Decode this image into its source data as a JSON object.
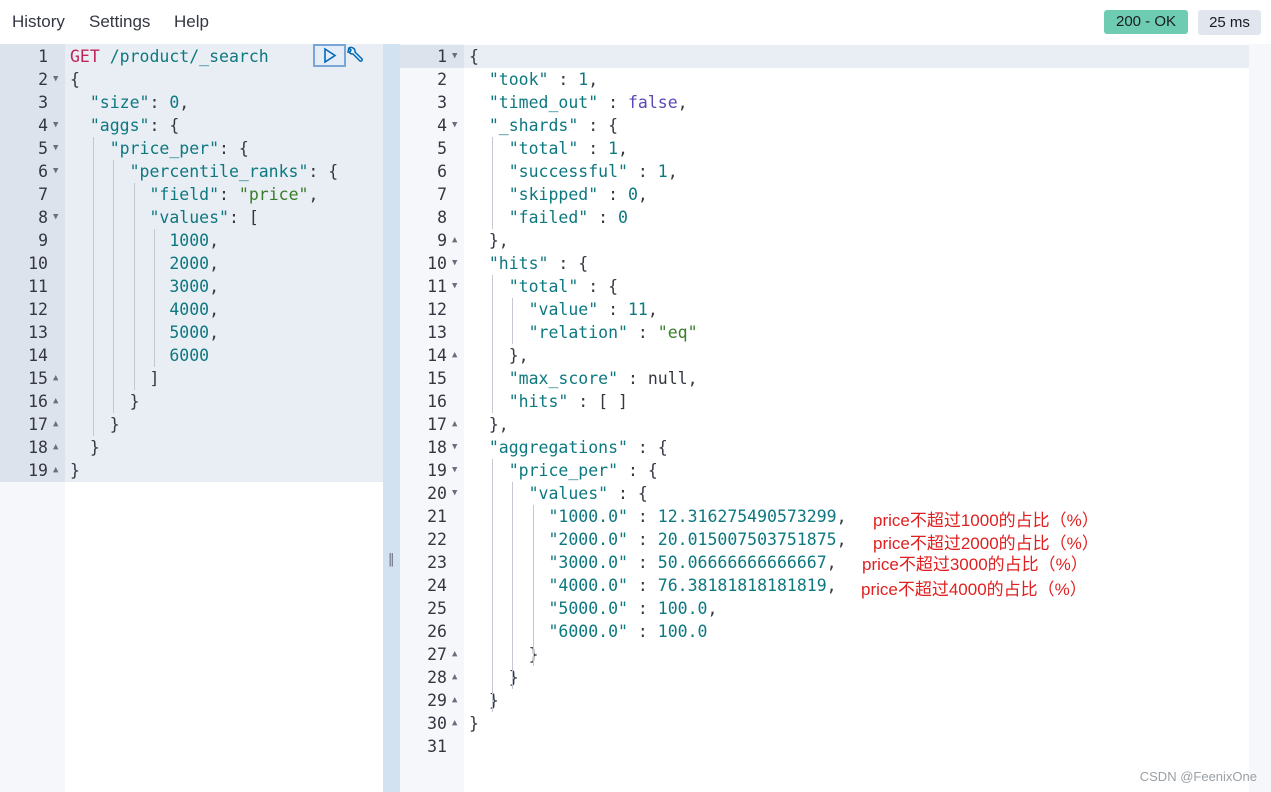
{
  "menu": {
    "history": "History",
    "settings": "Settings",
    "help": "Help"
  },
  "status": {
    "code": "200 - OK",
    "time": "25 ms"
  },
  "request": {
    "method": "GET",
    "path": "/product/_search",
    "lines": [
      [
        [
          "p",
          "{"
        ]
      ],
      [
        [
          "p",
          "  "
        ],
        [
          "k",
          "\"size\""
        ],
        [
          "p",
          ": "
        ],
        [
          "n",
          "0"
        ],
        [
          "p",
          ","
        ]
      ],
      [
        [
          "p",
          "  "
        ],
        [
          "k",
          "\"aggs\""
        ],
        [
          "p",
          ": {"
        ]
      ],
      [
        [
          "p",
          "    "
        ],
        [
          "k",
          "\"price_per\""
        ],
        [
          "p",
          ": {"
        ]
      ],
      [
        [
          "p",
          "      "
        ],
        [
          "k",
          "\"percentile_ranks\""
        ],
        [
          "p",
          ": {"
        ]
      ],
      [
        [
          "p",
          "        "
        ],
        [
          "k",
          "\"field\""
        ],
        [
          "p",
          ": "
        ],
        [
          "s",
          "\"price\""
        ],
        [
          "p",
          ","
        ]
      ],
      [
        [
          "p",
          "        "
        ],
        [
          "k",
          "\"values\""
        ],
        [
          "p",
          ": ["
        ]
      ],
      [
        [
          "p",
          "          "
        ],
        [
          "n",
          "1000"
        ],
        [
          "p",
          ","
        ]
      ],
      [
        [
          "p",
          "          "
        ],
        [
          "n",
          "2000"
        ],
        [
          "p",
          ","
        ]
      ],
      [
        [
          "p",
          "          "
        ],
        [
          "n",
          "3000"
        ],
        [
          "p",
          ","
        ]
      ],
      [
        [
          "p",
          "          "
        ],
        [
          "n",
          "4000"
        ],
        [
          "p",
          ","
        ]
      ],
      [
        [
          "p",
          "          "
        ],
        [
          "n",
          "5000"
        ],
        [
          "p",
          ","
        ]
      ],
      [
        [
          "p",
          "          "
        ],
        [
          "n",
          "6000"
        ]
      ],
      [
        [
          "p",
          "        ]"
        ]
      ],
      [
        [
          "p",
          "      }"
        ]
      ],
      [
        [
          "p",
          "    }"
        ]
      ],
      [
        [
          "p",
          "  }"
        ]
      ],
      [
        [
          "p",
          "}"
        ]
      ]
    ]
  },
  "response": {
    "lines": [
      [
        [
          "p",
          "{"
        ]
      ],
      [
        [
          "p",
          "  "
        ],
        [
          "k",
          "\"took\""
        ],
        [
          "p",
          " : "
        ],
        [
          "n",
          "1"
        ],
        [
          "p",
          ","
        ]
      ],
      [
        [
          "p",
          "  "
        ],
        [
          "k",
          "\"timed_out\""
        ],
        [
          "p",
          " : "
        ],
        [
          "kw",
          "false"
        ],
        [
          "p",
          ","
        ]
      ],
      [
        [
          "p",
          "  "
        ],
        [
          "k",
          "\"_shards\""
        ],
        [
          "p",
          " : {"
        ]
      ],
      [
        [
          "p",
          "    "
        ],
        [
          "k",
          "\"total\""
        ],
        [
          "p",
          " : "
        ],
        [
          "n",
          "1"
        ],
        [
          "p",
          ","
        ]
      ],
      [
        [
          "p",
          "    "
        ],
        [
          "k",
          "\"successful\""
        ],
        [
          "p",
          " : "
        ],
        [
          "n",
          "1"
        ],
        [
          "p",
          ","
        ]
      ],
      [
        [
          "p",
          "    "
        ],
        [
          "k",
          "\"skipped\""
        ],
        [
          "p",
          " : "
        ],
        [
          "n",
          "0"
        ],
        [
          "p",
          ","
        ]
      ],
      [
        [
          "p",
          "    "
        ],
        [
          "k",
          "\"failed\""
        ],
        [
          "p",
          " : "
        ],
        [
          "n",
          "0"
        ]
      ],
      [
        [
          "p",
          "  },"
        ]
      ],
      [
        [
          "p",
          "  "
        ],
        [
          "k",
          "\"hits\""
        ],
        [
          "p",
          " : {"
        ]
      ],
      [
        [
          "p",
          "    "
        ],
        [
          "k",
          "\"total\""
        ],
        [
          "p",
          " : {"
        ]
      ],
      [
        [
          "p",
          "      "
        ],
        [
          "k",
          "\"value\""
        ],
        [
          "p",
          " : "
        ],
        [
          "n",
          "11"
        ],
        [
          "p",
          ","
        ]
      ],
      [
        [
          "p",
          "      "
        ],
        [
          "k",
          "\"relation\""
        ],
        [
          "p",
          " : "
        ],
        [
          "s",
          "\"eq\""
        ]
      ],
      [
        [
          "p",
          "    },"
        ]
      ],
      [
        [
          "p",
          "    "
        ],
        [
          "k",
          "\"max_score\""
        ],
        [
          "p",
          " : null,"
        ]
      ],
      [
        [
          "p",
          "    "
        ],
        [
          "k",
          "\"hits\""
        ],
        [
          "p",
          " : [ ]"
        ]
      ],
      [
        [
          "p",
          "  },"
        ]
      ],
      [
        [
          "p",
          "  "
        ],
        [
          "k",
          "\"aggregations\""
        ],
        [
          "p",
          " : {"
        ]
      ],
      [
        [
          "p",
          "    "
        ],
        [
          "k",
          "\"price_per\""
        ],
        [
          "p",
          " : {"
        ]
      ],
      [
        [
          "p",
          "      "
        ],
        [
          "k",
          "\"values\""
        ],
        [
          "p",
          " : {"
        ]
      ],
      [
        [
          "p",
          "        "
        ],
        [
          "k",
          "\"1000.0\""
        ],
        [
          "p",
          " : "
        ],
        [
          "n",
          "12.316275490573299"
        ],
        [
          "p",
          ","
        ]
      ],
      [
        [
          "p",
          "        "
        ],
        [
          "k",
          "\"2000.0\""
        ],
        [
          "p",
          " : "
        ],
        [
          "n",
          "20.015007503751875"
        ],
        [
          "p",
          ","
        ]
      ],
      [
        [
          "p",
          "        "
        ],
        [
          "k",
          "\"3000.0\""
        ],
        [
          "p",
          " : "
        ],
        [
          "n",
          "50.06666666666667"
        ],
        [
          "p",
          ","
        ]
      ],
      [
        [
          "p",
          "        "
        ],
        [
          "k",
          "\"4000.0\""
        ],
        [
          "p",
          " : "
        ],
        [
          "n",
          "76.38181818181819"
        ],
        [
          "p",
          ","
        ]
      ],
      [
        [
          "p",
          "        "
        ],
        [
          "k",
          "\"5000.0\""
        ],
        [
          "p",
          " : "
        ],
        [
          "n",
          "100.0"
        ],
        [
          "p",
          ","
        ]
      ],
      [
        [
          "p",
          "        "
        ],
        [
          "k",
          "\"6000.0\""
        ],
        [
          "p",
          " : "
        ],
        [
          "n",
          "100.0"
        ]
      ],
      [
        [
          "p",
          "      }"
        ]
      ],
      [
        [
          "p",
          "    }"
        ]
      ],
      [
        [
          "p",
          "  }"
        ]
      ],
      [
        [
          "p",
          "}"
        ]
      ],
      [
        [
          "p",
          ""
        ]
      ]
    ]
  },
  "annotations": [
    "price不超过1000的占比（%）",
    "price不超过2000的占比（%）",
    "price不超过3000的占比（%）",
    "price不超过4000的占比（%）"
  ],
  "watermark": "CSDN @FeenixOne",
  "icons": {
    "run": "play-icon",
    "settings": "wrench-icon",
    "divider": "resize-handle-icon"
  }
}
